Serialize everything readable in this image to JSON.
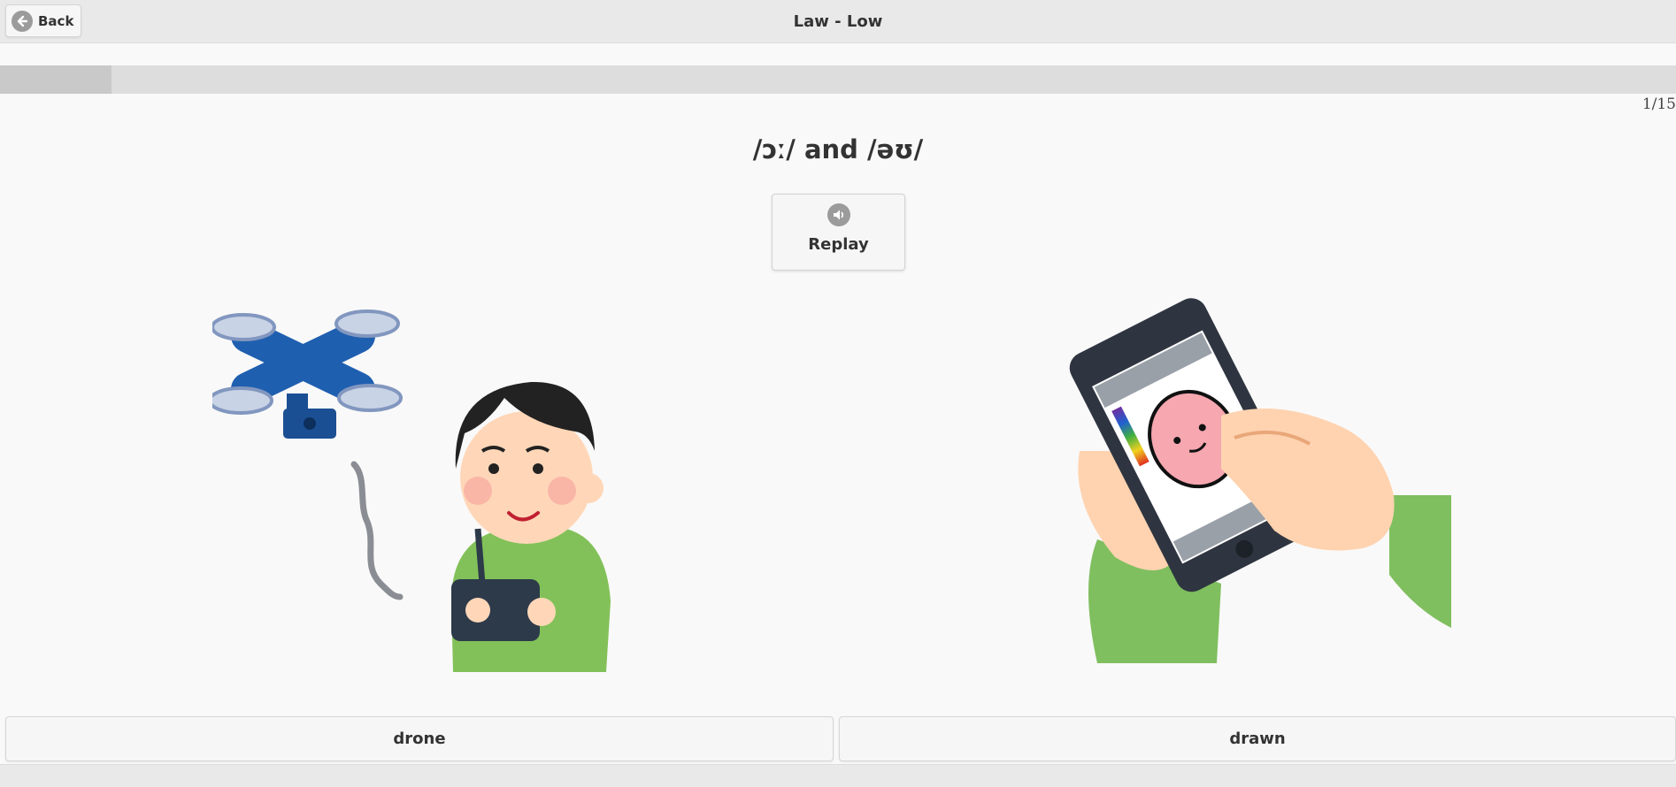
{
  "header": {
    "back_label": "Back",
    "back_icon": "arrow-left-circle-icon",
    "title": "Law - Low"
  },
  "progress": {
    "current": 1,
    "total": 15,
    "counter_text": "1/15",
    "fraction": 0.0667
  },
  "question": {
    "ipa": "/ɔː/ and /əʊ/",
    "replay_label": "Replay",
    "replay_icon": "speaker-icon"
  },
  "choices": [
    {
      "label": "drone",
      "illustration": "boy-flying-drone-illustration"
    },
    {
      "label": "drawn",
      "illustration": "hand-drawing-on-smartphone-illustration"
    }
  ],
  "colors": {
    "header_bg": "#e9e9e9",
    "page_bg": "#f9f9f9",
    "button_bg": "#f6f6f6",
    "icon_gray": "#9b9b9b",
    "drone_blue": "#1f5fb0",
    "shirt_green": "#82c159",
    "skin": "#ffd7b8"
  }
}
